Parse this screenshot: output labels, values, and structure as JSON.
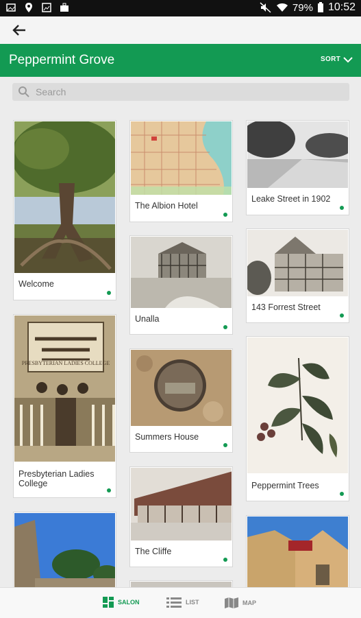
{
  "status": {
    "battery": "79%",
    "time": "10:52"
  },
  "header": {
    "title": "Peppermint Grove",
    "sort_label": "SORT"
  },
  "search": {
    "placeholder": "Search"
  },
  "cards": [
    {
      "caption": "Welcome"
    },
    {
      "caption": "The Albion Hotel"
    },
    {
      "caption": "Leake Street in 1902"
    },
    {
      "caption": "Unalla"
    },
    {
      "caption": "143 Forrest Street"
    },
    {
      "caption": "Presbyterian Ladies College"
    },
    {
      "caption": "Summers House"
    },
    {
      "caption": "Peppermint Trees"
    },
    {
      "caption": "The Cliffe"
    }
  ],
  "image_text": {
    "plc_sign": "PRESBYTERIAN LADIES COLLEGE"
  },
  "tabs": {
    "salon": "SALON",
    "list": "LIST",
    "map": "MAP"
  },
  "colors": {
    "accent": "#139a53",
    "statusbar": "#111111"
  }
}
